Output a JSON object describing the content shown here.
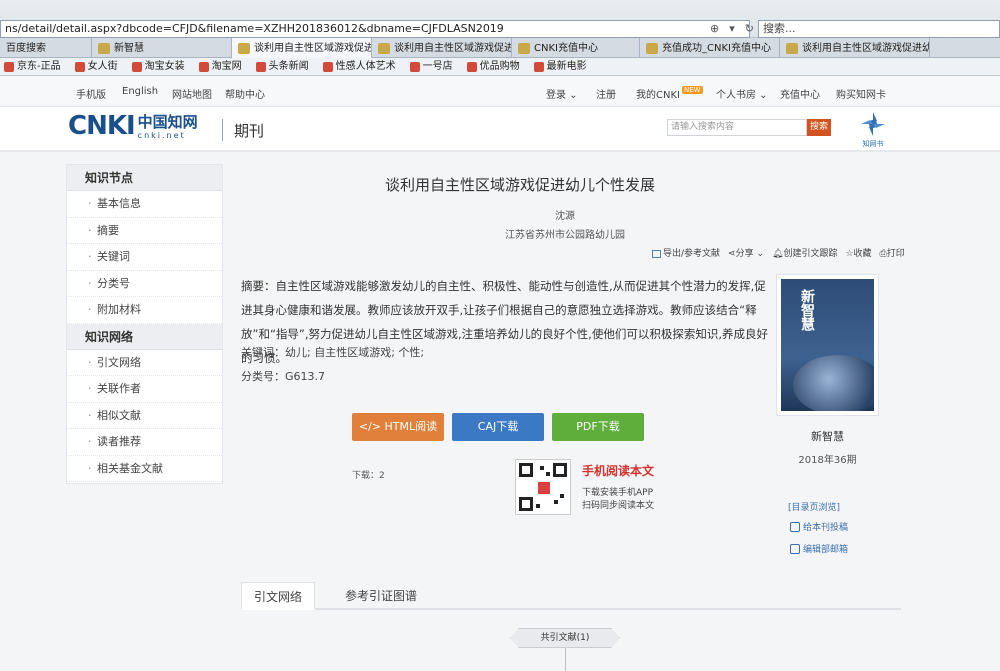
{
  "browser": {
    "url": "ns/detail/detail.aspx?dbcode=CFJD&filename=XZHH201836012&dbname=CJFDLASN2019",
    "search_placeholder": "搜索...",
    "tabs": [
      {
        "label": "百度搜索",
        "active": false
      },
      {
        "label": "新智慧",
        "active": false
      },
      {
        "label": "谈利用自主性区域游戏促进...",
        "active": true
      },
      {
        "label": "谈利用自主性区域游戏促进幼...",
        "active": false
      },
      {
        "label": "CNKI充值中心",
        "active": false
      },
      {
        "label": "充值成功_CNKI充值中心",
        "active": false
      },
      {
        "label": "谈利用自主性区域游戏促进幼...",
        "active": false
      }
    ],
    "favorites": [
      "京东-正品",
      "女人街",
      "淘宝女装",
      "淘宝网",
      "头条新闻",
      "性感人体艺术",
      "一号店",
      "优品购物",
      "最新电影"
    ]
  },
  "topnav": {
    "left": [
      "手机版",
      "English",
      "网站地图",
      "帮助中心"
    ],
    "login": "登录 ⌄",
    "register": "注册",
    "my_cnki": "我的CNKI",
    "new_badge": "NEW",
    "personal_bookroom": "个人书房 ⌄",
    "recharge": "充值中心",
    "buy_card": "购买知网卡"
  },
  "header": {
    "logo_text": "CNKI",
    "logo_zh": "中国知网",
    "logo_en": "cnki.net",
    "section": "期刊",
    "search_placeholder": "请输入搜索内容",
    "search_button": "搜索",
    "brand2": "知网书"
  },
  "sidebar": {
    "section1": "知识节点",
    "items1": [
      "基本信息",
      "摘要",
      "关键词",
      "分类号",
      "附加材料"
    ],
    "section2": "知识网络",
    "items2": [
      "引文网络",
      "关联作者",
      "相似文献",
      "读者推荐",
      "相关基金文献"
    ]
  },
  "article": {
    "title": "谈利用自主性区域游戏促进幼儿个性发展",
    "author": "沈源",
    "affiliation": "江苏省苏州市公园路幼儿园",
    "tools": [
      "导出/参考文献",
      "分享 ⌄",
      "创建引文跟踪",
      "收藏",
      "打印"
    ],
    "abstract": "摘要：自主性区域游戏能够激发幼儿的自主性、积极性、能动性与创造性,从而促进其个性潜力的发挥,促进其身心健康和谐发展。教师应该放开双手,让孩子们根据自己的意愿独立选择游戏。教师应该结合“释放”和“指导”,努力促进幼儿自主性区域游戏,注重培养幼儿的良好个性,使他们可以积极探索知识,养成良好的习惯。",
    "keywords": "关键词：幼儿; 自主性区域游戏; 个性;",
    "classification": "分类号：G613.7",
    "btn_html": "</> HTML阅读",
    "btn_caj": "CAJ下载",
    "btn_pdf": "PDF下载",
    "downloads": "下载：2",
    "mobile_title": "手机阅读本文",
    "mobile_line1": "下载安装手机APP",
    "mobile_line2": "扫码同步阅读本文"
  },
  "journal": {
    "cover_title": "新智慧",
    "name": "新智慧",
    "issue": "2018年36期",
    "dir_link": "[目录页浏览]",
    "submit_link": "给本刊投稿",
    "editorial_link": "编辑部邮箱"
  },
  "bottom": {
    "tab_active": "引文网络",
    "tab_other": "参考引证图谱",
    "cite_pill": "共引文献(1)"
  },
  "colors": {
    "btn_html": "#e0803a",
    "btn_caj": "#3c79c4",
    "btn_pdf": "#5fae3c",
    "brand_blue": "#1a4f8b",
    "accent_red": "#d2322d"
  }
}
